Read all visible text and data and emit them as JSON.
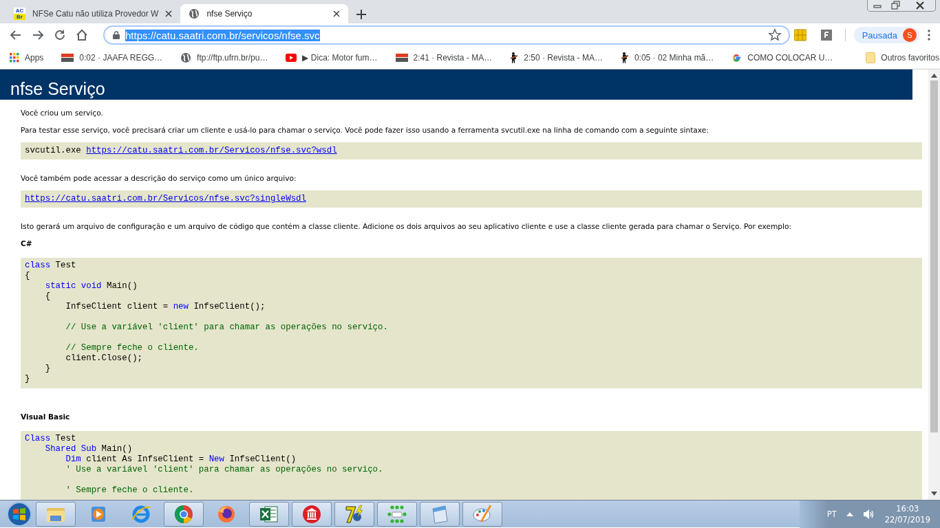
{
  "tabs": [
    {
      "title": "NFSe Catu não utiliza Provedor W",
      "kind": "logo",
      "logo": [
        "AC",
        "Br"
      ],
      "selected": false
    },
    {
      "title": "nfse Serviço",
      "kind": "globe",
      "selected": true
    }
  ],
  "address": {
    "url": "https://catu.saatri.com.br/servicos/nfse.svc"
  },
  "profile": {
    "label": "Pausada",
    "initial": "S"
  },
  "bookmarks": [
    {
      "label": "Apps",
      "kind": "apps"
    },
    {
      "label": "0:02 · JAAFA REGG…",
      "kind": "palco"
    },
    {
      "label": "ftp://ftp.ufrn.br/pu…",
      "kind": "globe"
    },
    {
      "label": "▶ Dica: Motor fum…",
      "kind": "youtube"
    },
    {
      "label": "2:41 · Revista - MA…",
      "kind": "palco"
    },
    {
      "label": "2:50 · Revista - MA…",
      "kind": "guitar"
    },
    {
      "label": "0:05 · 02 Minha mã…",
      "kind": "guitar"
    },
    {
      "label": "COMO COLOCAR U…",
      "kind": "google"
    }
  ],
  "other_bookmarks": "Outros favoritos",
  "page": {
    "title": "nfse Serviço",
    "content": [
      {
        "kind": "text",
        "text": "Você criou um serviço."
      },
      {
        "kind": "text",
        "text": "Para testar esse serviço, você precisará criar um cliente e usá-lo para chamar o serviço. Você pode fazer isso usando a ferramenta svcutil.exe na linha de comando com a seguinte sintaxe:"
      },
      {
        "kind": "command",
        "text": "svcutil.exe",
        "link": "https://catu.saatri.com.br/Servicos/nfse.svc?wsdl"
      },
      {
        "kind": "text",
        "text": "Você também pode acessar a descrição do serviço como um único arquivo:"
      },
      {
        "kind": "linkbox",
        "link": "https://catu.saatri.com.br/Servicos/nfse.svc?singleWsdl"
      },
      {
        "kind": "text",
        "text": "Isto gerará um arquivo de configuração e um arquivo de código que contém a classe cliente. Adicione os dois arquivos ao seu aplicativo cliente e use a classe cliente gerada para chamar o Serviço. Por exemplo:"
      },
      {
        "kind": "heading",
        "text": "C#"
      },
      {
        "kind": "code",
        "groups": [
          [
            [
              {
                "text": "class",
                "kind": "keyword"
              },
              {
                "text": " Test",
                "kind": "plain"
              }
            ],
            [
              {
                "text": "{",
                "kind": "plain"
              }
            ],
            [
              {
                "text": "    static void",
                "kind": "keyword"
              },
              {
                "text": " Main()",
                "kind": "plain"
              }
            ],
            [
              {
                "text": "    {",
                "kind": "plain"
              }
            ],
            [
              {
                "text": "        InfseClient client = ",
                "kind": "plain"
              },
              {
                "text": "new",
                "kind": "keyword"
              },
              {
                "text": " InfseClient();",
                "kind": "plain"
              }
            ]
          ],
          [
            [
              {
                "text": "        // Use a variável 'client' para chamar as operações no serviço.",
                "kind": "comment"
              }
            ]
          ],
          [
            [
              {
                "text": "        // Sempre feche o cliente.",
                "kind": "comment"
              }
            ],
            [
              {
                "text": "        client.Close();",
                "kind": "plain"
              }
            ],
            [
              {
                "text": "    }",
                "kind": "plain"
              }
            ],
            [
              {
                "text": "}",
                "kind": "plain"
              }
            ]
          ]
        ]
      },
      {
        "kind": "heading",
        "text": "Visual Basic"
      },
      {
        "kind": "code",
        "groups": [
          [
            [
              {
                "text": "Class",
                "kind": "keyword"
              },
              {
                "text": " Test",
                "kind": "plain"
              }
            ],
            [
              {
                "text": "    Shared Sub",
                "kind": "keyword"
              },
              {
                "text": " Main()",
                "kind": "plain"
              }
            ],
            [
              {
                "text": "        Dim",
                "kind": "keyword"
              },
              {
                "text": " client As InfseClient = ",
                "kind": "plain"
              },
              {
                "text": "New",
                "kind": "keyword"
              },
              {
                "text": " InfseClient()",
                "kind": "plain"
              }
            ],
            [
              {
                "text": "        ' Use a variável 'client' para chamar as operações no serviço.",
                "kind": "comment"
              }
            ]
          ],
          [
            [
              {
                "text": "        ' Sempre feche o cliente.",
                "kind": "comment"
              }
            ]
          ]
        ]
      }
    ]
  },
  "taskbar": {
    "apps": [
      {
        "kind": "folder",
        "open": true
      },
      {
        "kind": "media",
        "open": false
      },
      {
        "kind": "ie",
        "open": false
      },
      {
        "kind": "chrome",
        "open": true
      },
      {
        "kind": "firefox",
        "open": false
      },
      {
        "kind": "excel",
        "open": true
      },
      {
        "kind": "bank",
        "open": true
      },
      {
        "kind": "seven",
        "open": true
      },
      {
        "kind": "ib",
        "open": true
      },
      {
        "kind": "notepad",
        "open": true
      },
      {
        "kind": "paint",
        "open": true
      }
    ],
    "language": "PT",
    "time": "16:03",
    "date": "22/07/2019"
  }
}
